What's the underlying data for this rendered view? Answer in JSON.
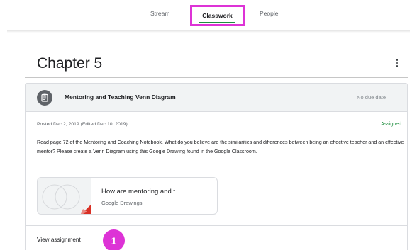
{
  "tabs": {
    "stream": "Stream",
    "classwork": "Classwork",
    "people": "People"
  },
  "topic": {
    "title": "Chapter 5"
  },
  "assignment": {
    "icon": "assignment-icon",
    "title": "Mentoring and Teaching Venn Diagram",
    "due": "No due date",
    "posted": "Posted Dec 2, 2019 (Edited Dec 10, 2019)",
    "status": "Assigned",
    "instructions": "Read page 72 of the Mentoring and Coaching Notebook. What do you believe are the similarities and differences between being an effective teacher and an effective mentor? Please create a Venn Diagram using this Google Drawing found in the Google Classroom.",
    "attachment": {
      "title": "How are mentoring and t...",
      "type": "Google Drawings"
    },
    "view_label": "View assignment"
  },
  "annotation": {
    "step": "1",
    "color": "#dd33d6"
  },
  "colors": {
    "accent": "#1e8e3e",
    "highlight": "#dd33d6"
  }
}
